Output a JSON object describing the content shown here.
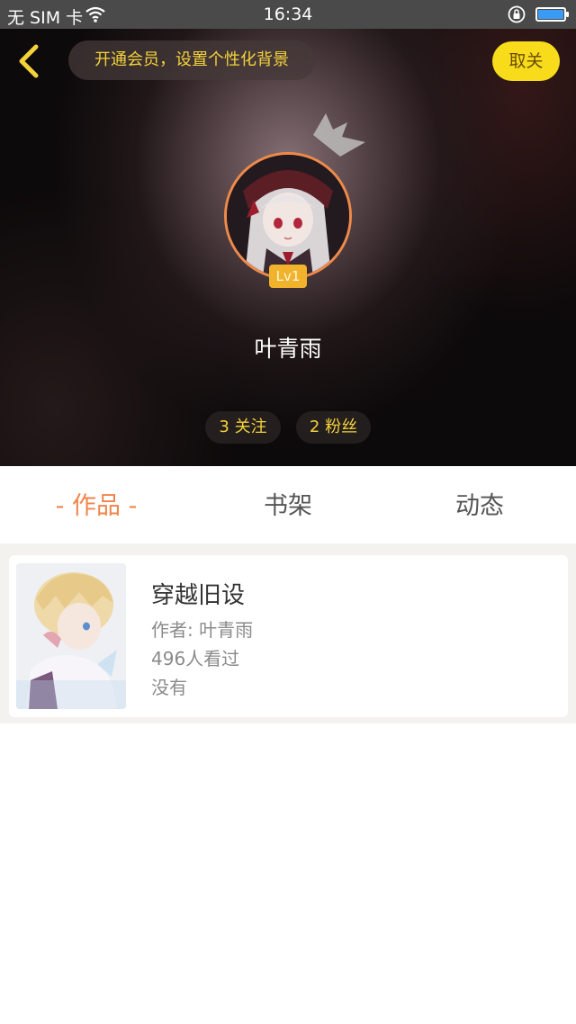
{
  "status_bar": {
    "carrier": "无 SIM 卡",
    "time": "16:34",
    "wifi_icon": "wifi-icon",
    "lock_icon": "rotation-lock-icon",
    "battery_icon": "battery-icon",
    "battery_color": "#3a9bf5"
  },
  "header": {
    "back_icon": "chevron-left-icon",
    "vip_banner": "开通会员，设置个性化背景",
    "unfollow_label": "取关",
    "accent_yellow": "#f8dc1c"
  },
  "profile": {
    "crown_icon": "crown-icon",
    "level": "Lv1",
    "name": "叶青雨",
    "following": "3 关注",
    "fans": "2 粉丝"
  },
  "tabs": [
    {
      "label": "- 作品 -",
      "active": true
    },
    {
      "label": "书架",
      "active": false
    },
    {
      "label": "动态",
      "active": false
    }
  ],
  "accent_orange": "#f0854a",
  "works": [
    {
      "title": "穿越旧设",
      "author": "作者: 叶青雨",
      "views": "496人看过",
      "description": "没有"
    }
  ]
}
